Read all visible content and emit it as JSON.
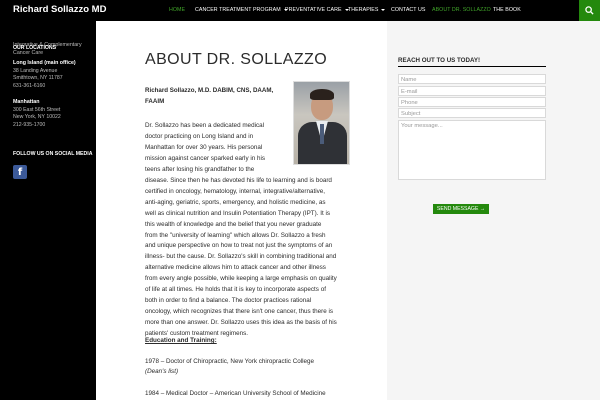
{
  "site": {
    "title": "Richard Sollazzo MD",
    "tagline": "Integrative & Complementary Cancer Care"
  },
  "nav": {
    "items": [
      {
        "label": "HOME",
        "dropdown": false,
        "state": "active-text"
      },
      {
        "label": "CANCER TREATMENT PROGRAM",
        "dropdown": true,
        "state": ""
      },
      {
        "label": "PREVENTATIVE CARE",
        "dropdown": true,
        "state": ""
      },
      {
        "label": "THERAPIES",
        "dropdown": true,
        "state": ""
      },
      {
        "label": "CONTACT US",
        "dropdown": false,
        "state": ""
      },
      {
        "label": "ABOUT DR. SOLLAZZO",
        "dropdown": false,
        "state": "current"
      },
      {
        "label": "THE BOOK",
        "dropdown": false,
        "state": ""
      }
    ],
    "search_icon": "search-icon"
  },
  "sidebar": {
    "locations_title": "OUR LOCATIONS",
    "locations": [
      {
        "name": "Long Island (main office)",
        "lines": [
          "38 Landing Avenue",
          "Smithtown, NY 11787",
          "631-361-6160"
        ]
      },
      {
        "name": "Manhattan",
        "lines": [
          "300 East 56th Street",
          "New York, NY 10022",
          "212-935-1700"
        ]
      }
    ],
    "social_title": "FOLLOW US ON SOCIAL MEDIA",
    "social_icon": "facebook-icon"
  },
  "main": {
    "page_title": "ABOUT DR. SOLLAZZO",
    "author_lines": [
      "Richard Sollazzo, M.D. DABIM, CNS, DAAM,",
      "FAAIM"
    ],
    "bio_lines": [
      "Dr. Sollazzo has been a dedicated medical",
      "doctor practicing on Long Island and in",
      "Manhattan for over 30 years. His personal",
      "mission against cancer sparked early in his",
      "teens after losing his grandfather to the",
      "disease. Since then he has devoted his life to learning and is board",
      "certified in oncology, hematology, internal, integrative/alternative,",
      "anti-aging, geriatric, sports, emergency, and holistic medicine, as",
      "well as clinical nutrition and Insulin Potentiation Therapy (IPT). It is",
      "this wealth of knowledge and the belief that you never graduate",
      "from the \"university of learning\" which allows Dr. Sollazzo a fresh",
      "and unique perspective on how to treat not just the symptoms of an",
      "illness- but the cause. Dr. Sollazzo's skill in combining traditional and",
      "alternative medicine allows him to attack cancer and other illness",
      "from every angle possible, while keeping a large emphasis on quality",
      "of life at all times. He holds that it is key to incorporate aspects of",
      "both in order to find a balance. The doctor practices rational",
      "oncology, which recognizes that there isn't one cancer, thus there is",
      "more than one answer. Dr. Sollazzo uses this idea as the basis of his",
      "patients' custom treatment regimens."
    ],
    "education_heading": "Education and Training:",
    "education": [
      {
        "text": "1978 – Doctor of Chiropractic,  New York chiropractic College",
        "note": "(Dean's list)"
      },
      {
        "text": "1984 – Medical Doctor – American University School of Medicine",
        "note": ""
      }
    ]
  },
  "contact_form": {
    "title": "REACH OUT TO US TODAY!",
    "name_placeholder": "Name",
    "email_placeholder": "E-mail",
    "phone_placeholder": "Phone",
    "subject_placeholder": "Subject",
    "message_placeholder": "Your message...",
    "send_label": "SEND MESSAGE →"
  },
  "colors": {
    "accent": "#24890d",
    "accent_text": "#41a62a",
    "topbar": "#000000",
    "facebook": "#3b5998"
  }
}
